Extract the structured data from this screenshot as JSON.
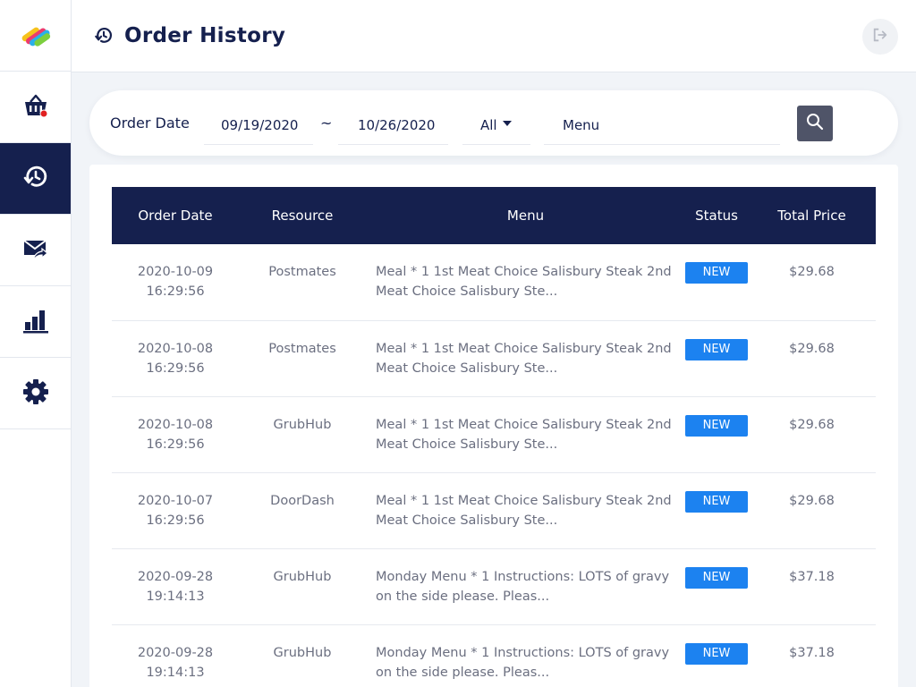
{
  "sidebar": {
    "logo_icon": "brand-logo-icon",
    "items": [
      {
        "icon": "basket-icon",
        "active": false
      },
      {
        "icon": "order-history-icon",
        "active": true
      },
      {
        "icon": "mail-forward-icon",
        "active": false
      },
      {
        "icon": "bar-chart-icon",
        "active": false
      },
      {
        "icon": "gear-icon",
        "active": false
      }
    ]
  },
  "header": {
    "title": "Order History",
    "icon": "order-history-icon",
    "logout_icon": "logout-icon"
  },
  "filters": {
    "label": "Order Date",
    "start_date": "09/19/2020",
    "separator": "~",
    "end_date": "10/26/2020",
    "resource_select": "All",
    "menu_value": "Menu",
    "search_icon": "search-icon"
  },
  "table": {
    "columns": [
      "Order Date",
      "Resource",
      "Menu",
      "Status",
      "Total Price"
    ],
    "rows": [
      {
        "date": "2020-10-09",
        "time": "16:29:56",
        "resource": "Postmates",
        "menu": "Meal * 1 1st Meat Choice Salisbury Steak 2nd Meat Choice Salisbury Ste...",
        "status": "NEW",
        "price": "$29.68"
      },
      {
        "date": "2020-10-08",
        "time": "16:29:56",
        "resource": "Postmates",
        "menu": "Meal * 1 1st Meat Choice Salisbury Steak 2nd Meat Choice Salisbury Ste...",
        "status": "NEW",
        "price": "$29.68"
      },
      {
        "date": "2020-10-08",
        "time": "16:29:56",
        "resource": "GrubHub",
        "menu": "Meal * 1 1st Meat Choice Salisbury Steak 2nd Meat Choice Salisbury Ste...",
        "status": "NEW",
        "price": "$29.68"
      },
      {
        "date": "2020-10-07",
        "time": "16:29:56",
        "resource": "DoorDash",
        "menu": "Meal * 1 1st Meat Choice Salisbury Steak 2nd Meat Choice Salisbury Ste...",
        "status": "NEW",
        "price": "$29.68"
      },
      {
        "date": "2020-09-28",
        "time": "19:14:13",
        "resource": "GrubHub",
        "menu": "Monday Menu * 1 Instructions: LOTS of gravy on the side please. Pleas...",
        "status": "NEW",
        "price": "$37.18"
      },
      {
        "date": "2020-09-28",
        "time": "19:14:13",
        "resource": "GrubHub",
        "menu": "Monday Menu * 1 Instructions: LOTS of gravy on the side please. Pleas...",
        "status": "NEW",
        "price": "$37.18"
      }
    ]
  },
  "colors": {
    "navy": "#15204e",
    "status_blue": "#1c82f0",
    "alert_red": "#e02020",
    "search_button": "#4f5468"
  }
}
